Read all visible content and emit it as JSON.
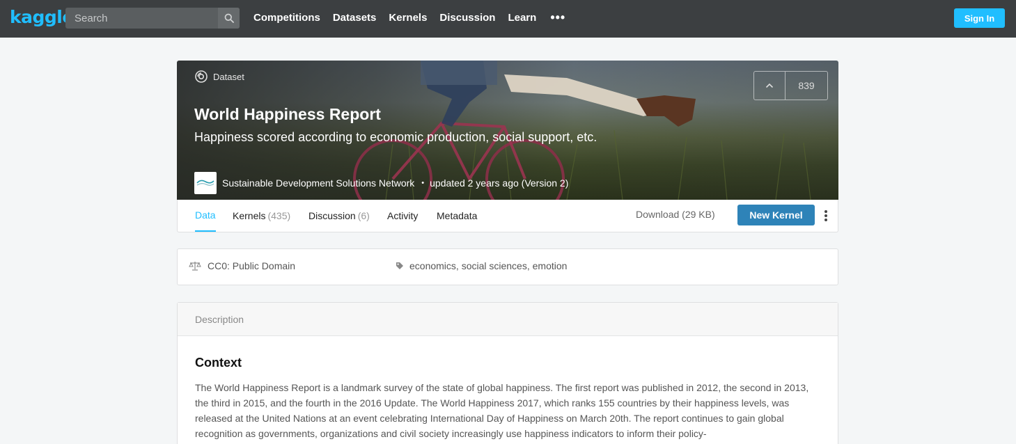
{
  "nav": {
    "logo": "kaggle",
    "search_placeholder": "Search",
    "links": [
      "Competitions",
      "Datasets",
      "Kernels",
      "Discussion",
      "Learn"
    ],
    "more": "•••",
    "signin": "Sign In"
  },
  "hero": {
    "tag": "Dataset",
    "title": "World Happiness Report",
    "subtitle": "Happiness scored according to economic production, social support, etc.",
    "owner": "Sustainable Development Solutions Network",
    "owner_sep": "•",
    "updated": "updated 2 years ago (Version 2)",
    "votes": "839"
  },
  "tabs": {
    "data": "Data",
    "kernels": "Kernels",
    "kernels_count": "(435)",
    "discussion": "Discussion",
    "discussion_count": "(6)",
    "activity": "Activity",
    "metadata": "Metadata",
    "download": "Download (29 KB)",
    "new_kernel": "New Kernel"
  },
  "info": {
    "license": "CC0: Public Domain",
    "tags": "economics, social sciences, emotion"
  },
  "description": {
    "header": "Description",
    "heading": "Context",
    "paragraph": "The World Happiness Report is a landmark survey of the state of global happiness. The first report was published in 2012, the second in 2013, the third in 2015, and the fourth in the 2016 Update. The World Happiness 2017, which ranks 155 countries by their happiness levels, was released at the United Nations at an event celebrating International Day of Happiness on March 20th. The report continues to gain global recognition as governments, organizations and civil society increasingly use happiness indicators to inform their policy-"
  },
  "colors": {
    "nav_bg": "#3c3f41",
    "accent": "#20beff",
    "new_kernel_bg": "#2e83b8",
    "page_bg": "#f4f6f7"
  }
}
